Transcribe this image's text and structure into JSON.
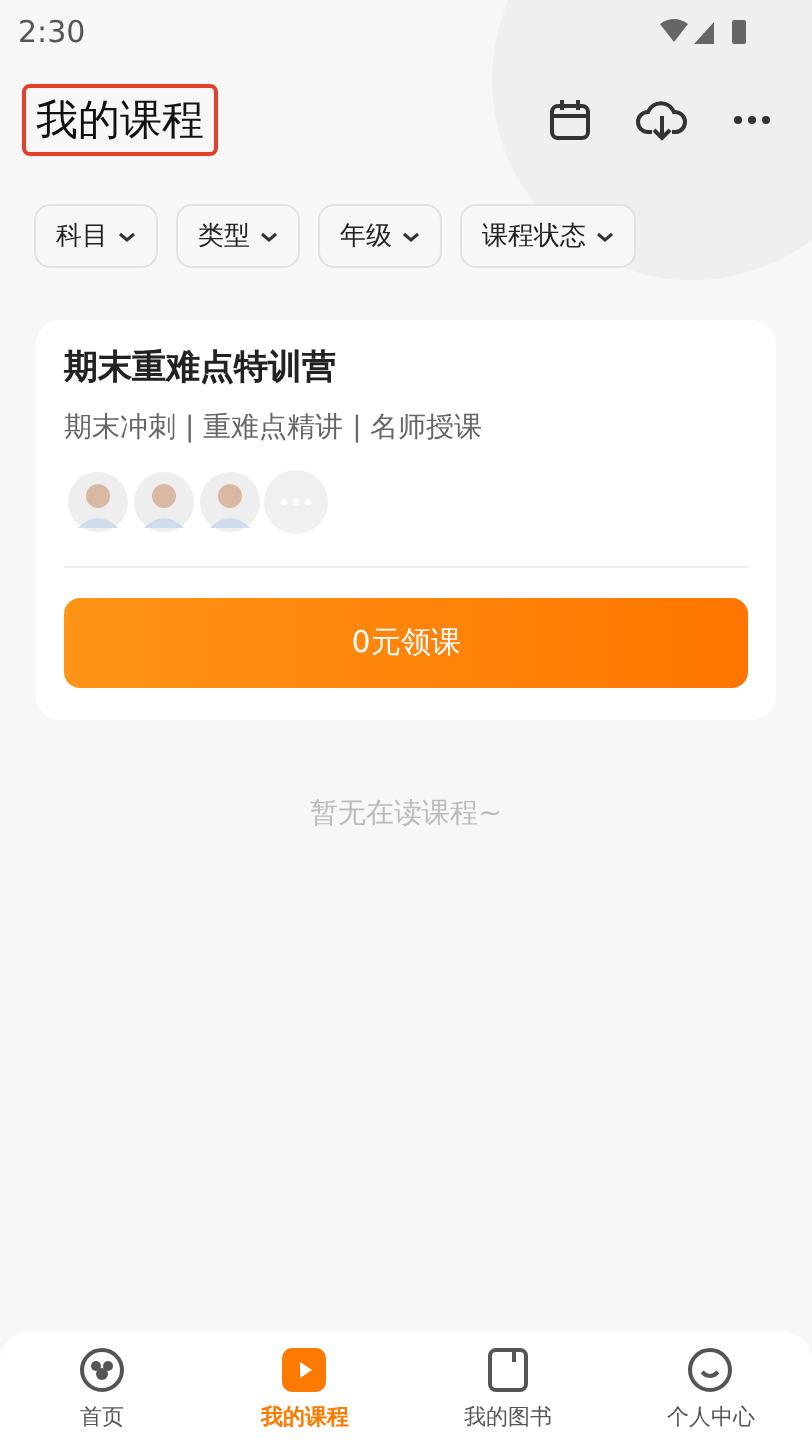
{
  "status_bar": {
    "time": "2:30"
  },
  "header": {
    "title": "我的课程"
  },
  "filters": [
    {
      "label": "科目"
    },
    {
      "label": "类型"
    },
    {
      "label": "年级"
    },
    {
      "label": "课程状态"
    }
  ],
  "course": {
    "title": "期末重难点特训营",
    "subtitle": "期末冲刺 | 重难点精讲 | 名师授课",
    "teachers": [
      {
        "kind": "avatar"
      },
      {
        "kind": "avatar"
      },
      {
        "kind": "avatar"
      },
      {
        "kind": "more"
      }
    ],
    "button": "0元领课"
  },
  "empty_hint": "暂无在读课程~",
  "tabs": [
    {
      "label": "首页",
      "selected": false,
      "kind": "home"
    },
    {
      "label": "我的课程",
      "selected": true,
      "kind": "course"
    },
    {
      "label": "我的图书",
      "selected": false,
      "kind": "book"
    },
    {
      "label": "个人中心",
      "selected": false,
      "kind": "me"
    }
  ]
}
